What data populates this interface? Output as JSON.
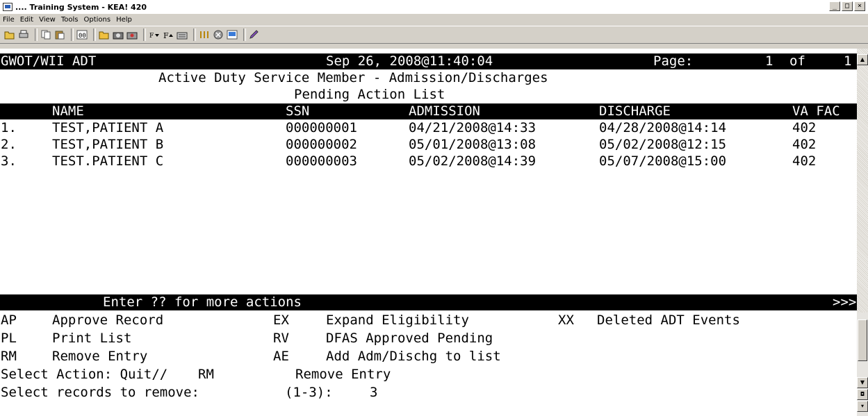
{
  "window": {
    "title": ".... Training System - KEA! 420",
    "controls": [
      "_",
      "□",
      "×"
    ]
  },
  "menu": [
    "File",
    "Edit",
    "View",
    "Tools",
    "Options",
    "Help"
  ],
  "toolbar_icons": [
    "open-icon",
    "print-icon",
    "copy-icon",
    "paste-icon",
    "connect-icon",
    "folder-icon",
    "camera-icon",
    "record-icon",
    "font-decrease-icon",
    "font-increase-icon",
    "keyboard-icon",
    "transfer-icon",
    "stop-icon",
    "screen-icon",
    "pencil-icon"
  ],
  "header": {
    "system": "GWOT/WII ADT",
    "datetime": "Sep 26, 2008@11:40:04",
    "page_label": "Page:",
    "page_current": "1",
    "page_of": "of",
    "page_total": "1"
  },
  "title_line1": "Active Duty Service Member - Admission/Discharges",
  "title_line2": "Pending Action List",
  "columns": {
    "name": "NAME",
    "ssn": "SSN",
    "admission": "ADMISSION",
    "discharge": "DISCHARGE",
    "va_fac": "VA FAC"
  },
  "rows": [
    {
      "num": "1.",
      "name": "TEST,PATIENT A",
      "ssn": "000000001",
      "admission": "04/21/2008@14:33",
      "discharge": "04/28/2008@14:14",
      "fac": "402"
    },
    {
      "num": "2.",
      "name": "TEST,PATIENT B",
      "ssn": "000000002",
      "admission": "05/01/2008@13:08",
      "discharge": "05/02/2008@12:15",
      "fac": "402"
    },
    {
      "num": "3.",
      "name": "TEST.PATIENT C",
      "ssn": "000000003",
      "admission": "05/02/2008@14:39",
      "discharge": "05/07/2008@15:00",
      "fac": "402"
    }
  ],
  "actions_bar": {
    "text": "Enter ?? for more actions",
    "more": ">>>"
  },
  "actions": [
    {
      "code": "AP",
      "label": "Approve Record"
    },
    {
      "code": "EX",
      "label": "Expand Eligibility"
    },
    {
      "code": "XX",
      "label": "Deleted ADT Events"
    },
    {
      "code": "PL",
      "label": "Print List"
    },
    {
      "code": "RV",
      "label": "DFAS Approved Pending"
    },
    {
      "code": "RM",
      "label": "Remove Entry"
    },
    {
      "code": "AE",
      "label": "Add Adm/Dischg to list"
    }
  ],
  "prompt1": {
    "label": "Select Action: Quit//",
    "input": "RM",
    "echo": "Remove Entry"
  },
  "prompt2": {
    "label": "Select records to remove:",
    "range": "(1-3):",
    "input": "3"
  }
}
